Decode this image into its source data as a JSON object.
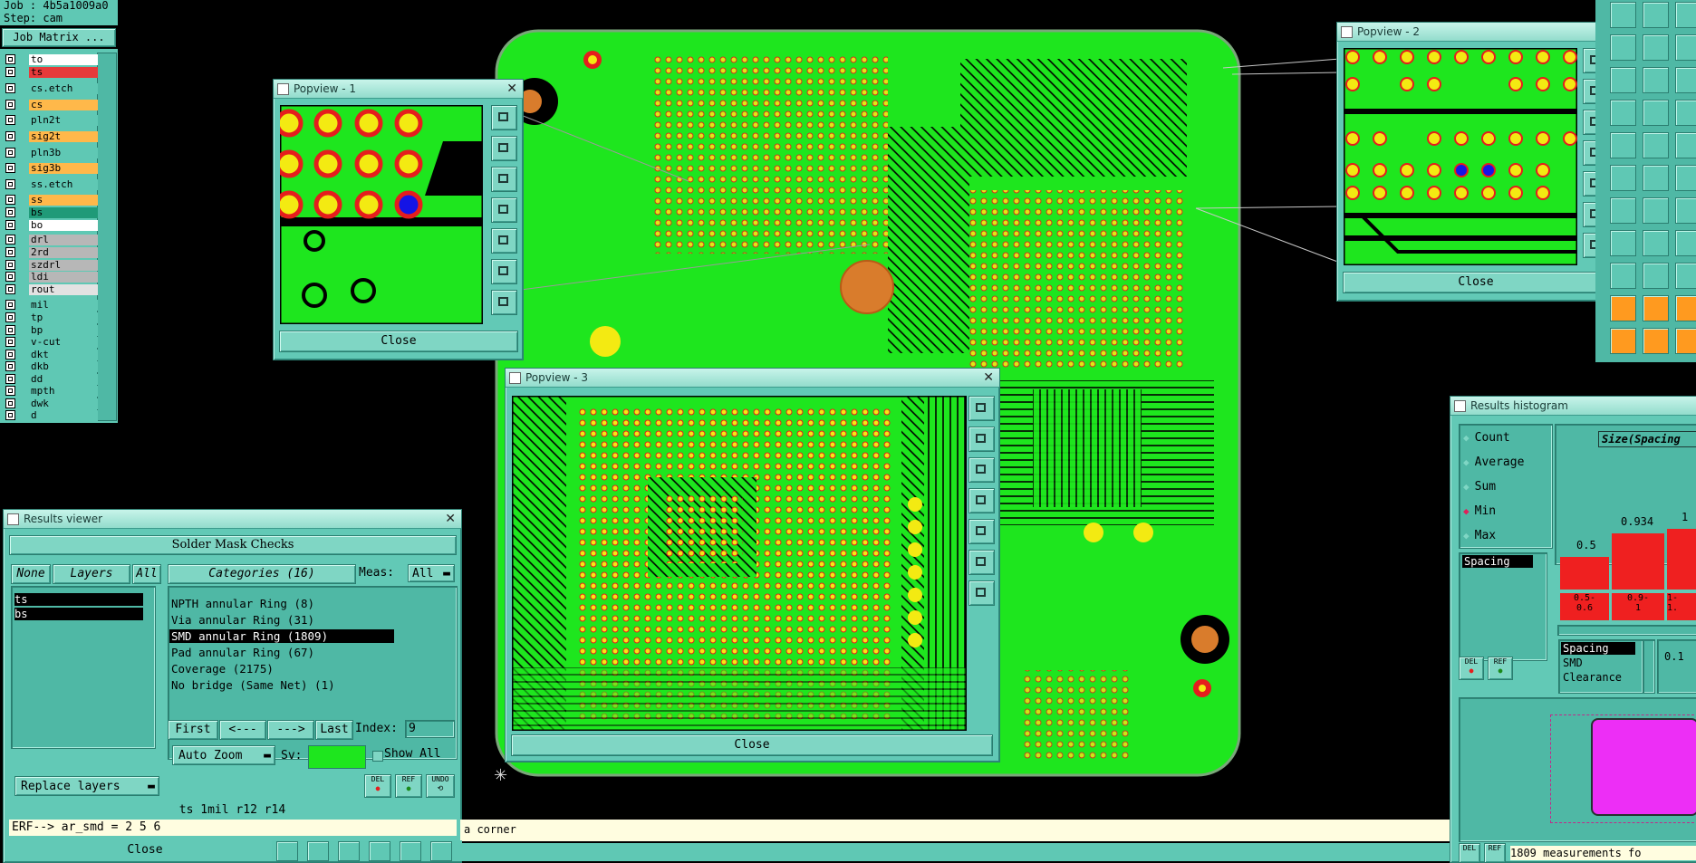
{
  "job": {
    "job_label": "Job : 4b5a1009a0",
    "step_label": "Step: cam",
    "matrix_button": "Job Matrix ..."
  },
  "layers": [
    {
      "name": "to",
      "color": "#ffffff"
    },
    {
      "name": "ts",
      "color": "#e63a3a"
    },
    {
      "name": "cs.etch",
      "color": "#5fc8b4"
    },
    {
      "name": "cs",
      "color": "#ffb84a"
    },
    {
      "name": "pln2t",
      "color": "#5fc8b4"
    },
    {
      "name": "sig2t",
      "color": "#ffb84a"
    },
    {
      "name": "pln3b",
      "color": "#5fc8b4"
    },
    {
      "name": "sig3b",
      "color": "#ffb84a"
    },
    {
      "name": "ss.etch",
      "color": "#5fc8b4"
    },
    {
      "name": "ss",
      "color": "#ffb84a"
    },
    {
      "name": "bs",
      "color": "#1f9a78"
    },
    {
      "name": "bo",
      "color": "#ffffff"
    },
    {
      "name": "drl",
      "color": "#b7b7b7"
    },
    {
      "name": "2rd",
      "color": "#b7b7b7"
    },
    {
      "name": "szdrl",
      "color": "#b7b7b7"
    },
    {
      "name": "ldi",
      "color": "#b7b7b7"
    },
    {
      "name": "rout",
      "color": "#e2e2e2"
    },
    {
      "name": "mil",
      "color": "#5fc8b4"
    },
    {
      "name": "tp",
      "color": "#5fc8b4"
    },
    {
      "name": "bp",
      "color": "#5fc8b4"
    },
    {
      "name": "v-cut",
      "color": "#5fc8b4"
    },
    {
      "name": "dkt",
      "color": "#5fc8b4"
    },
    {
      "name": "dkb",
      "color": "#5fc8b4"
    },
    {
      "name": "dd",
      "color": "#5fc8b4"
    },
    {
      "name": "mpth",
      "color": "#5fc8b4"
    },
    {
      "name": "dwk",
      "color": "#5fc8b4"
    },
    {
      "name": "d",
      "color": "#5fc8b4"
    }
  ],
  "popview1": {
    "title": "Popview - 1",
    "close": "Close"
  },
  "popview2": {
    "title": "Popview - 2",
    "close": "Close"
  },
  "popview3": {
    "title": "Popview - 3",
    "close": "Close"
  },
  "results_viewer": {
    "title": "Results viewer",
    "header": "Solder Mask Checks",
    "none_btn": "None",
    "layers_btn": "Layers",
    "all_btn": "All",
    "layer_items": [
      "ts",
      "bs"
    ],
    "categories_btn": "Categories (16)",
    "meas_label": "Meas:",
    "meas_value": "All",
    "categories": [
      "NPTH annular Ring (8)",
      "Via annular Ring (31)",
      "SMD annular Ring (1809)",
      "Pad annular Ring (67)",
      "Coverage (2175)",
      "No bridge (Same Net) (1)"
    ],
    "selected_category": "SMD annular Ring (1809)",
    "first_btn": "First",
    "prev_btn": "<---",
    "next_btn": "--->",
    "last_btn": "Last",
    "index_label": "Index:",
    "index_value": "9",
    "auto_zoom": "Auto Zoom",
    "sv_label": "Sv:",
    "show_all": "Show All",
    "replace_layers": "Replace layers",
    "del_btn": "DEL",
    "ref_btn": "REF",
    "undo_btn": "UNDO",
    "status_line": "ts 1mil   r12   r14",
    "erf_line": "ERF--> ar_smd = 2 5 6",
    "close": "Close"
  },
  "bottom_message": "a corner",
  "histogram": {
    "title": "Results histogram",
    "options": [
      "Count",
      "Average",
      "Sum",
      "Min",
      "Max"
    ],
    "selected_option": "Min",
    "list_item": "Spacing",
    "size_label": "Size(Spacing",
    "bar_labels": [
      "0.5",
      "0.934",
      "1"
    ],
    "bin_labels": [
      "0.5-\n0.6",
      "0.9-\n1",
      "1-\n1."
    ],
    "types": [
      "Spacing",
      "SMD",
      "Clearance"
    ],
    "spin_value": "0.1",
    "del_btn": "DEL",
    "ref_btn": "REF",
    "footer": "1809 measurements fo"
  },
  "colors": {
    "teal": "#5fc8b4",
    "board_green": "#1ee61e",
    "copper_pad_yellow": "#f3ea12",
    "pad_ring_red": "#e51d1d",
    "selected_black": "#000000",
    "histogram_bar_red": "#ef2020",
    "magenta_map": "#ff20ff"
  },
  "icons": [
    "popview-zoom-icon",
    "popview-pan-icon",
    "toolbar-arrow-icon",
    "close-icon"
  ]
}
